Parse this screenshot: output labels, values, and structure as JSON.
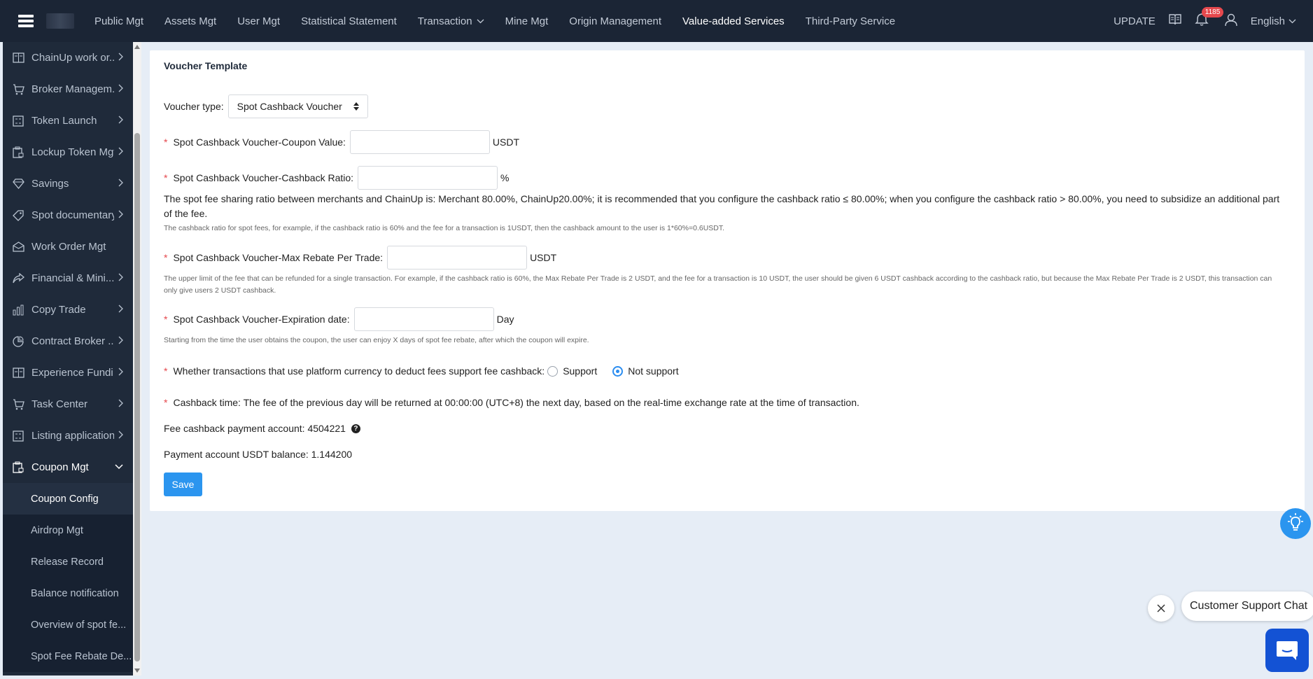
{
  "topbar": {
    "nav": [
      {
        "label": "Public Mgt"
      },
      {
        "label": "Assets Mgt"
      },
      {
        "label": "User Mgt"
      },
      {
        "label": "Statistical Statement"
      },
      {
        "label": "Transaction"
      },
      {
        "label": "Mine Mgt"
      },
      {
        "label": "Origin Management"
      },
      {
        "label": "Value-added Services",
        "active": true
      },
      {
        "label": "Third-Party Service"
      }
    ],
    "update_label": "UPDATE",
    "notification_count": "1185",
    "language": "English"
  },
  "sidebar": {
    "items": [
      {
        "label": "ChainUp work or..."
      },
      {
        "label": "Broker Managem..."
      },
      {
        "label": "Token Launch"
      },
      {
        "label": "Lockup Token Mgt"
      },
      {
        "label": "Savings"
      },
      {
        "label": "Spot documentary"
      },
      {
        "label": "Work Order Mgt"
      },
      {
        "label": "Financial & Mini..."
      },
      {
        "label": "Copy Trade"
      },
      {
        "label": "Contract Broker ..."
      },
      {
        "label": "Experience Fundi..."
      },
      {
        "label": "Task Center"
      },
      {
        "label": "Listing application"
      },
      {
        "label": "Coupon Mgt"
      }
    ],
    "sub_items": [
      {
        "label": "Coupon Config"
      },
      {
        "label": "Airdrop Mgt"
      },
      {
        "label": "Release Record"
      },
      {
        "label": "Balance notification"
      },
      {
        "label": "Overview of spot fe..."
      },
      {
        "label": "Spot Fee Rebate De..."
      }
    ]
  },
  "form": {
    "title": "Voucher Template",
    "voucher_type_label": "Voucher type:",
    "voucher_type_value": "Spot Cashback Voucher",
    "coupon_value_label": "Spot Cashback Voucher-Coupon Value:",
    "coupon_value_unit": "USDT",
    "ratio_label": "Spot Cashback Voucher-Cashback Ratio:",
    "ratio_unit": "%",
    "ratio_note": "The spot fee sharing ratio between merchants and ChainUp is: Merchant 80.00%, ChainUp20.00%; it is recommended that you configure the cashback ratio ≤ 80.00%; when you configure the cashback ratio > 80.00%, you need to subsidize an additional part of the fee.",
    "ratio_small": "The cashback ratio for spot fees,   for example, if the cashback ratio is 60% and the fee for a transaction is 1USDT, then the cashback amount to the user is 1*60%=0.6USDT.",
    "max_rebate_label": "Spot Cashback Voucher-Max Rebate Per Trade:",
    "max_rebate_unit": "USDT",
    "max_rebate_small": "The upper limit of the fee that can be refunded for a single transaction. For example, if the cashback ratio is 60%, the Max Rebate Per Trade is 2 USDT, and the fee for a transaction is 10 USDT, the user should be given 6 USDT cashback according to the cashback ratio, but because the Max Rebate Per Trade is 2 USDT, this transaction can only give users 2 USDT cashback.",
    "expiration_label": "Spot Cashback Voucher-Expiration date:",
    "expiration_unit": "Day",
    "expiration_small": "Starting from the time the user obtains the coupon, the user can enjoy X days of spot fee rebate, after which the coupon will expire.",
    "platform_currency_label": "Whether transactions that use platform currency to deduct fees support fee cashback:",
    "support_label": "Support",
    "not_support_label": "Not support",
    "cashback_time": "Cashback time: The fee of the previous day will be returned at 00:00:00 (UTC+8) the next day, based on the real-time exchange rate at the time of transaction.",
    "payment_account": "Fee cashback payment account: 4504221",
    "payment_balance": "Payment account USDT balance: 1.144200",
    "save_label": "Save"
  },
  "chat": {
    "label": "Customer Support Chat"
  },
  "colors": {
    "topbar_bg": "#1b2535",
    "sidebar_bg": "#1f2a3a",
    "accent": "#2b95ef",
    "chat_button": "#1352d4",
    "required": "#e5484d"
  }
}
